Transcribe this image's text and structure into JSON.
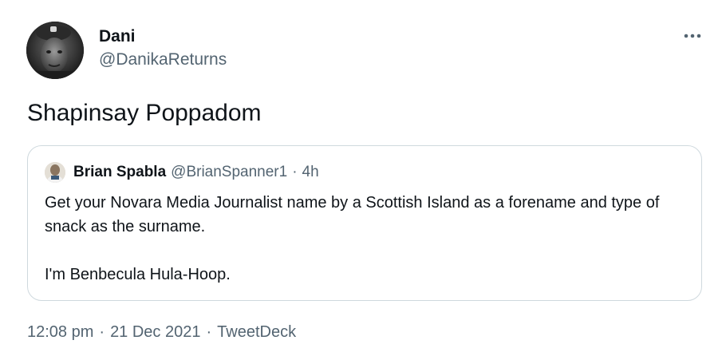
{
  "author": {
    "display_name": "Dani",
    "handle": "@DanikaReturns",
    "avatar_icon": "profile-photo-miner"
  },
  "more_icon": "more-horizontal-icon",
  "tweet": {
    "text": "Shapinsay Poppadom"
  },
  "quoted_tweet": {
    "author_name": "Brian Spabla",
    "author_handle": "@BrianSpanner1",
    "separator": "·",
    "time": "4h",
    "avatar_icon": "profile-photo",
    "paragraph_1": "Get your Novara Media Journalist name by a Scottish Island as a forename and type of snack as the surname.",
    "paragraph_2": "I'm Benbecula Hula-Hoop."
  },
  "meta": {
    "time": "12:08 pm",
    "separator": "·",
    "date": "21 Dec 2021",
    "source": "TweetDeck"
  },
  "colors": {
    "text_primary": "#0f1419",
    "text_secondary": "#536471",
    "border": "#cfd9de"
  }
}
